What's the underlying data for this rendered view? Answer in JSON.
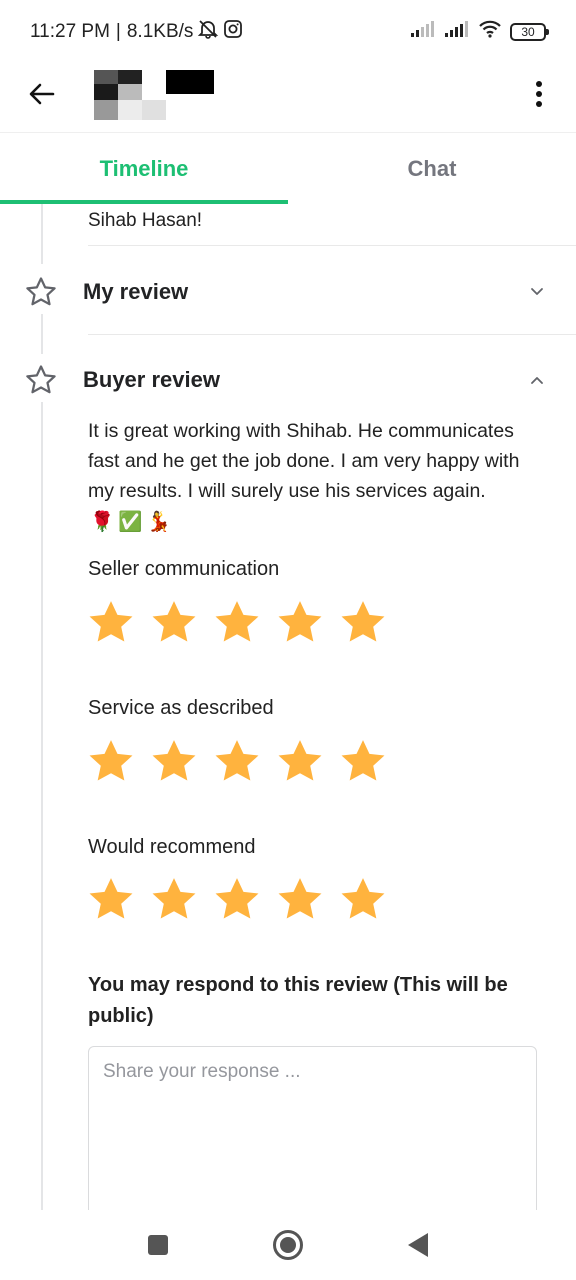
{
  "status_bar": {
    "time": "11:27 PM",
    "separator": "|",
    "network_speed": "8.1KB/s",
    "battery_level": "30",
    "icons": [
      "muted-bell-icon",
      "instagram-icon",
      "signal-icon",
      "signal-icon",
      "wifi-icon",
      "battery-icon"
    ]
  },
  "header": {
    "back_icon": "arrow-left-icon",
    "more_icon": "more-vertical-icon"
  },
  "tabs": [
    {
      "label": "Timeline",
      "active": true
    },
    {
      "label": "Chat",
      "active": false
    }
  ],
  "timeline": {
    "previous_text": "Sihab Hasan!",
    "my_review": {
      "title": "My review",
      "expanded": false
    },
    "buyer_review": {
      "title": "Buyer review",
      "expanded": true,
      "text": "It is great working with  Shihab. He communicates fast and he get the job done. I am very happy with my results. I will surely use his services again.",
      "emojis": [
        "🌹",
        "✅",
        "💃"
      ],
      "ratings": [
        {
          "label": "Seller communication",
          "stars": 5,
          "max": 5
        },
        {
          "label": "Service as described",
          "stars": 5,
          "max": 5
        },
        {
          "label": "Would recommend",
          "stars": 5,
          "max": 5
        }
      ]
    },
    "respond_title": "You may respond to this review (This will be public)",
    "response_placeholder": "Share your response ..."
  },
  "colors": {
    "accent": "#1dbf73",
    "star": "#ffb33e",
    "text": "#222325",
    "muted": "#74767e"
  },
  "nav_bar": {
    "icons": [
      "recents-square-icon",
      "home-circle-icon",
      "back-triangle-icon"
    ]
  }
}
